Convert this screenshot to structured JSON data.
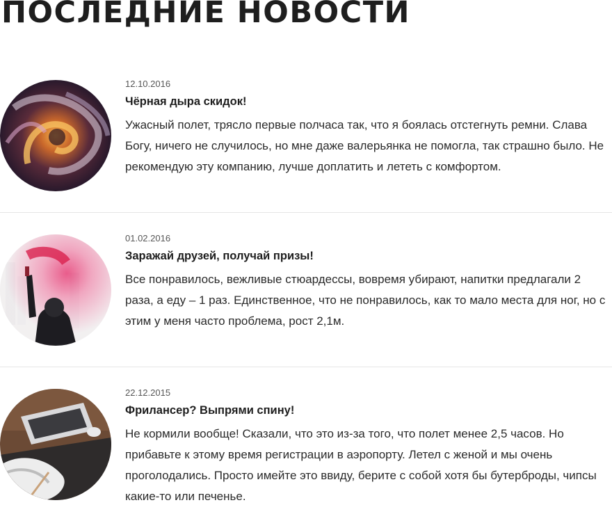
{
  "page": {
    "title": "ПОСЛЕДНИЕ НОВОСТИ"
  },
  "news": [
    {
      "date": "12.10.2016",
      "title": "Чёрная дыра скидок!",
      "text": "Ужасный полет, трясло первые полчаса так, что я боялась отстегнуть ремни. Слава Богу, ничего не случилось, но мне даже валерьянка не помогла, так страшно было. Не рекомендую эту компанию, лучше доплатить и лететь с комфортом.",
      "image": "cosmic-swirl-image"
    },
    {
      "date": "01.02.2016",
      "title": "Заражай друзей, получай призы!",
      "text": "Все понравилось, вежливые стюардессы, вовремя убирают, напитки предлагали 2 раза, а еду – 1 раз. Единственное, что не понравилось, как то мало места для ног, но с этим у меня часто проблема, рост 2,1м.",
      "image": "flare-protester-image"
    },
    {
      "date": "22.12.2015",
      "title": "Фрилансер? Выпрями спину!",
      "text": "Не кормили вообще! Сказали, что это из-за того, что полет менее 2,5 часов. Но прибавьте к этому время регистрации в аэропорту. Летел с женой и мы очень проголодались. Просто имейте это ввиду, берите с собой хотя бы бутерброды, чипсы какие-то или печенье.",
      "image": "laptop-desk-image"
    }
  ]
}
